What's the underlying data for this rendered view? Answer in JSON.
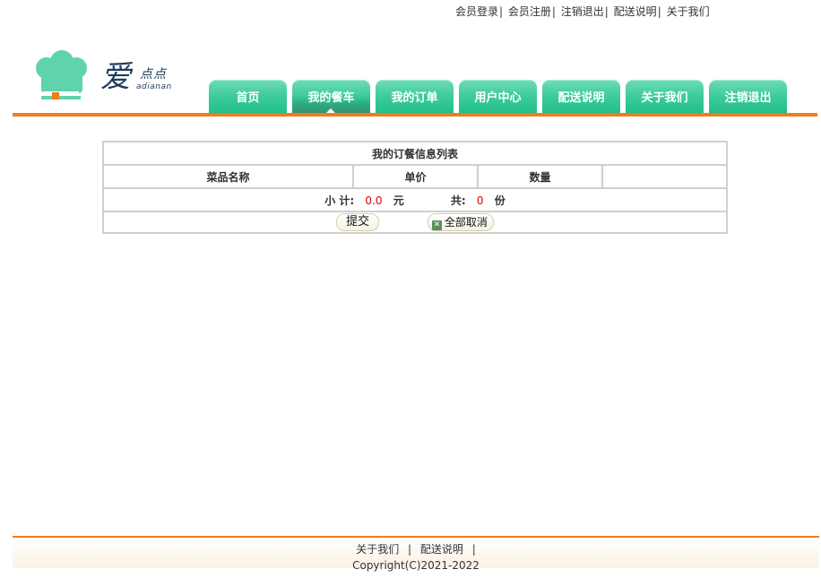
{
  "top_links": [
    "会员登录",
    "会员注册",
    "注销退出",
    "配送说明",
    "关于我们"
  ],
  "top_sep": "|",
  "logo": {
    "main": "爱",
    "dd": "点点",
    "sub": "adianan"
  },
  "nav": {
    "tabs": [
      "首页",
      "我的餐车",
      "我的订单",
      "用户中心",
      "配送说明",
      "关于我们",
      "注销退出"
    ],
    "active_index": 1
  },
  "cart": {
    "caption": "我的订餐信息列表",
    "columns": [
      "菜品名称",
      "单价",
      "数量",
      ""
    ],
    "subtotal_label": "小 计:",
    "subtotal_value": "0.0",
    "currency": "元",
    "total_label": "共:",
    "total_count": "0",
    "count_unit": "份",
    "submit_label": "提交",
    "cancel_all_label": "全部取消"
  },
  "footer": {
    "links": [
      "关于我们",
      "配送说明"
    ],
    "sep": "|",
    "copyright": "Copyright(C)2021-2022"
  },
  "colors": {
    "accent_orange": "#ef7d1a",
    "nav_green": "#3fcc9c",
    "price_red": "#e00000"
  }
}
